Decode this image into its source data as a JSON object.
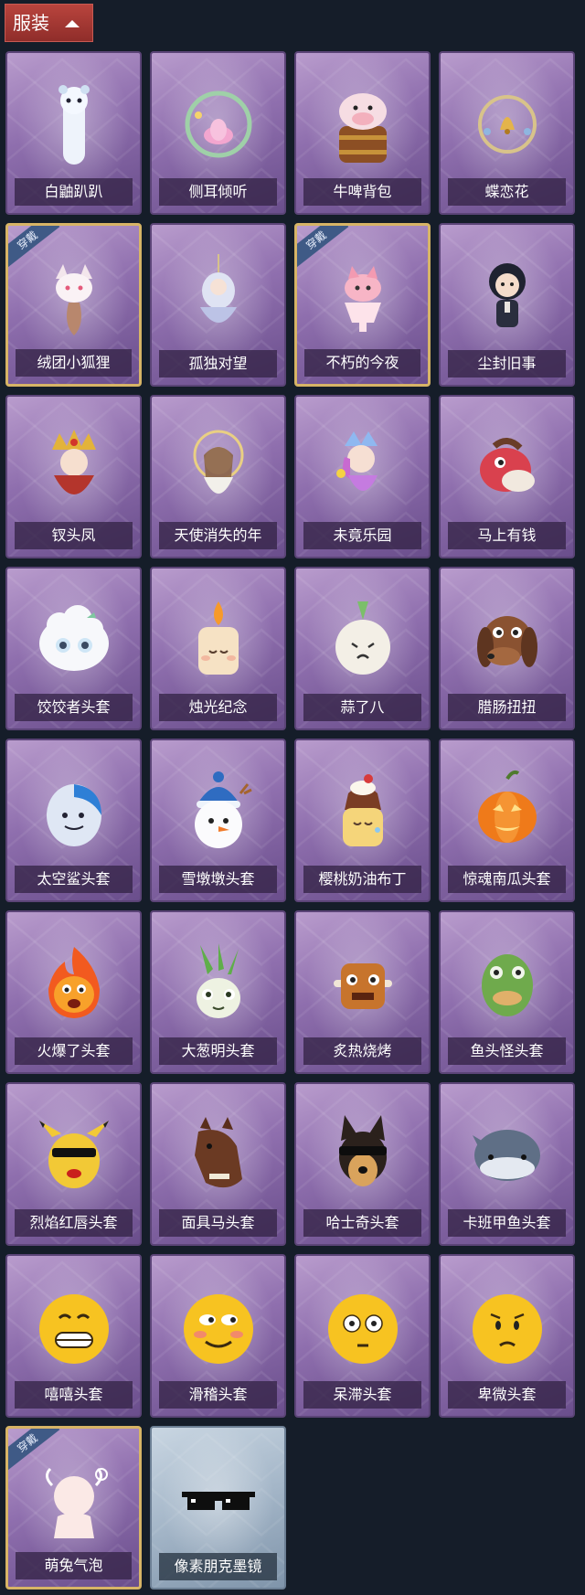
{
  "header": {
    "label": "服装"
  },
  "worn_badge": "穿戴",
  "items": [
    {
      "name": "白鼬趴趴",
      "worn": false,
      "theme": "purple",
      "icon": "white-ferret-icon"
    },
    {
      "name": "侧耳倾听",
      "worn": false,
      "theme": "purple",
      "icon": "lotus-wreath-icon"
    },
    {
      "name": "牛啤背包",
      "worn": false,
      "theme": "purple",
      "icon": "cow-barrel-icon"
    },
    {
      "name": "蝶恋花",
      "worn": false,
      "theme": "purple",
      "icon": "bell-wreath-icon"
    },
    {
      "name": "绒团小狐狸",
      "worn": true,
      "theme": "purple",
      "icon": "fox-icon"
    },
    {
      "name": "孤独对望",
      "worn": false,
      "theme": "purple",
      "icon": "doll-charm-icon"
    },
    {
      "name": "不朽的今夜",
      "worn": true,
      "theme": "purple",
      "icon": "pink-fox-cup-icon"
    },
    {
      "name": "尘封旧事",
      "worn": false,
      "theme": "purple",
      "icon": "chibi-gentleman-icon"
    },
    {
      "name": "钗头凤",
      "worn": false,
      "theme": "purple",
      "icon": "phoenix-crown-doll-icon"
    },
    {
      "name": "天使消失的年",
      "worn": false,
      "theme": "purple",
      "icon": "angel-doll-icon"
    },
    {
      "name": "未竟乐园",
      "worn": false,
      "theme": "purple",
      "icon": "jester-doll-icon"
    },
    {
      "name": "马上有钱",
      "worn": false,
      "theme": "purple",
      "icon": "red-horse-icon"
    },
    {
      "name": "饺饺者头套",
      "worn": false,
      "theme": "purple",
      "icon": "dumpling-head-icon"
    },
    {
      "name": "烛光纪念",
      "worn": false,
      "theme": "purple",
      "icon": "candle-head-icon"
    },
    {
      "name": "蒜了八",
      "worn": false,
      "theme": "purple",
      "icon": "garlic-head-icon"
    },
    {
      "name": "腊肠扭扭",
      "worn": false,
      "theme": "purple",
      "icon": "dachshund-head-icon"
    },
    {
      "name": "太空鲨头套",
      "worn": false,
      "theme": "purple",
      "icon": "shark-head-icon"
    },
    {
      "name": "雪墩墩头套",
      "worn": false,
      "theme": "purple",
      "icon": "snowman-head-icon"
    },
    {
      "name": "樱桃奶油布丁",
      "worn": false,
      "theme": "purple",
      "icon": "pudding-head-icon"
    },
    {
      "name": "惊魂南瓜头套",
      "worn": false,
      "theme": "purple",
      "icon": "pumpkin-head-icon"
    },
    {
      "name": "火爆了头套",
      "worn": false,
      "theme": "purple",
      "icon": "fire-head-icon"
    },
    {
      "name": "大葱明头套",
      "worn": false,
      "theme": "purple",
      "icon": "scallion-head-icon"
    },
    {
      "name": "炙热烧烤",
      "worn": false,
      "theme": "purple",
      "icon": "bbq-meat-head-icon"
    },
    {
      "name": "鱼头怪头套",
      "worn": false,
      "theme": "purple",
      "icon": "fish-man-head-icon"
    },
    {
      "name": "烈焰红唇头套",
      "worn": false,
      "theme": "purple",
      "icon": "yellow-mouse-head-icon"
    },
    {
      "name": "面具马头套",
      "worn": false,
      "theme": "purple",
      "icon": "horse-mask-head-icon"
    },
    {
      "name": "哈士奇头套",
      "worn": false,
      "theme": "purple",
      "icon": "husky-head-icon"
    },
    {
      "name": "卡班甲鱼头套",
      "worn": false,
      "theme": "purple",
      "icon": "whale-head-icon"
    },
    {
      "name": "嘻嘻头套",
      "worn": false,
      "theme": "purple",
      "icon": "grin-emoji-head-icon"
    },
    {
      "name": "滑稽头套",
      "worn": false,
      "theme": "purple",
      "icon": "funny-emoji-head-icon"
    },
    {
      "name": "呆滞头套",
      "worn": false,
      "theme": "purple",
      "icon": "dazed-emoji-head-icon"
    },
    {
      "name": "卑微头套",
      "worn": false,
      "theme": "purple",
      "icon": "humble-emoji-head-icon"
    },
    {
      "name": "萌兔气泡",
      "worn": true,
      "theme": "purple",
      "icon": "bunny-bubble-icon"
    },
    {
      "name": "像素朋克墨镜",
      "worn": false,
      "theme": "silver",
      "icon": "pixel-sunglasses-icon"
    }
  ]
}
